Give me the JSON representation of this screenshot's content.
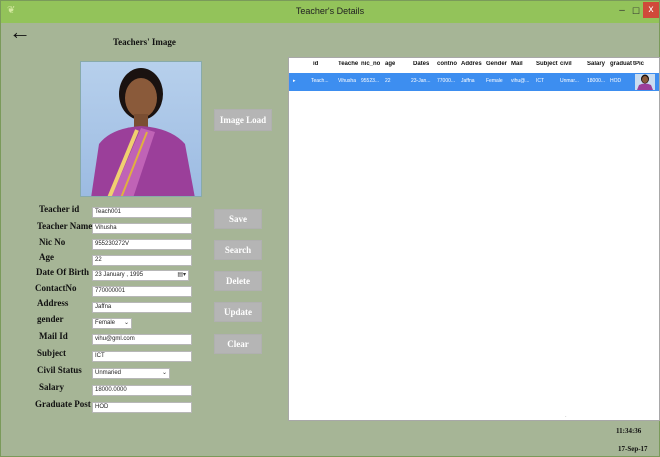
{
  "window": {
    "title": "Teacher's Details",
    "minimize": "–",
    "maximize": "☐",
    "close": "x"
  },
  "image_caption": "Teachers' Image",
  "buttons": {
    "image_load": "Image Load",
    "save": "Save",
    "search": "Search",
    "delete": "Delete",
    "update": "Update",
    "clear": "Clear"
  },
  "form": {
    "teacher_id": {
      "label": "Teacher id",
      "value": "Teach001"
    },
    "teacher_name": {
      "label": "Teacher Name",
      "value": "Vihusha"
    },
    "nic_no": {
      "label": "Nic No",
      "value": "955230272V"
    },
    "age": {
      "label": "Age",
      "value": "22"
    },
    "dob": {
      "label": "Date Of Birth",
      "value": "23  January  , 1995"
    },
    "contact": {
      "label": "ContactNo",
      "value": "770000001"
    },
    "address": {
      "label": "Address",
      "value": "Jaffna"
    },
    "gender": {
      "label": "gender",
      "value": "Female"
    },
    "mail": {
      "label": "Mail Id",
      "value": "vihu@gml.com"
    },
    "subject": {
      "label": "Subject",
      "value": "ICT"
    },
    "civil": {
      "label": "Civil  Status",
      "value": "Unmaried"
    },
    "salary": {
      "label": "Salary",
      "value": "18000.0000"
    },
    "graduate": {
      "label": "Graduate Post",
      "value": "HOD"
    }
  },
  "grid": {
    "columns": [
      "id",
      "Teache",
      "nic_no",
      "age",
      "Dates",
      "contno",
      "Addres",
      "Gender",
      "Mail",
      "Subject",
      "civil",
      "Salary",
      "graduat",
      "tPic"
    ],
    "row": [
      "Teach...",
      "Vihusha",
      "95523...",
      "22",
      "23-Jan...",
      "77000...",
      "Jaffna",
      "Female",
      "vihu@...",
      "ICT",
      "Unmar...",
      "18000...",
      "HOD"
    ],
    "row_marker": "▸"
  },
  "footer": {
    "time": "11:34:36",
    "date": "17-Sep-17"
  }
}
